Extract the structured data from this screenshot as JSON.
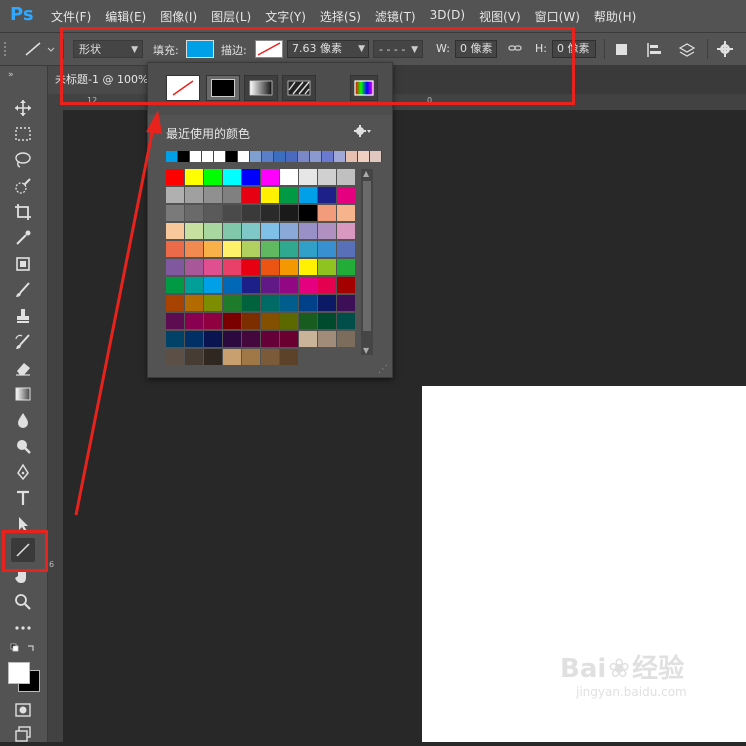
{
  "app": {
    "logo": "Ps"
  },
  "menu": [
    "文件(F)",
    "编辑(E)",
    "图像(I)",
    "图层(L)",
    "文字(Y)",
    "选择(S)",
    "滤镜(T)",
    "3D(D)",
    "视图(V)",
    "窗口(W)",
    "帮助(H)"
  ],
  "options": {
    "shape_mode": "形状",
    "fill_label": "填充:",
    "fill_color": "#00a0e9",
    "stroke_label": "描边:",
    "stroke_width": "7.63 像素",
    "w_label": "W:",
    "w_value": "0 像素",
    "h_label": "H:",
    "h_value": "0 像素"
  },
  "document": {
    "tab_title": "未标题-1 @ 100%"
  },
  "popup": {
    "recent_label": "最近使用的颜色",
    "recent_colors": [
      "#00a0e9",
      "#000000",
      "#ffffff",
      "#ffffff",
      "#ffffff",
      "#000000",
      "#ffffff",
      "#7f9fd0",
      "#5b7ec8",
      "#3c6ec0",
      "#4a6ac0",
      "#7b88c8",
      "#8a9ad0",
      "#6a7ad0",
      "#a0a8d8",
      "#e8c0b0",
      "#f0d0c0",
      "#e0c8c0"
    ],
    "swatches": [
      "#ff0000",
      "#ffff00",
      "#00ff00",
      "#00ffff",
      "#0000ff",
      "#ff00ff",
      "#ffffff",
      "#e6e6e6",
      "#d0d0d0",
      "#c0c0c0",
      "#b0b0b0",
      "#a0a0a0",
      "#909090",
      "#808080",
      "#e60012",
      "#fff100",
      "#009944",
      "#00a0e9",
      "#1d2088",
      "#e4007f",
      "#7a7a7a",
      "#6a6a6a",
      "#5a5a5a",
      "#4a4a4a",
      "#3a3a3a",
      "#2a2a2a",
      "#1a1a1a",
      "#000000",
      "#f29c7c",
      "#f5b48c",
      "#f8c89a",
      "#c7e0a0",
      "#a8d8a0",
      "#80c8a8",
      "#80c8c8",
      "#80c0e8",
      "#8aa8d8",
      "#9a90c8",
      "#b090c0",
      "#d898c0",
      "#ea6a4a",
      "#f08a50",
      "#f8b048",
      "#fff06a",
      "#b0d060",
      "#60b860",
      "#30a890",
      "#30a0c8",
      "#3890d0",
      "#5870b8",
      "#8058a0",
      "#a85898",
      "#e05090",
      "#e84068",
      "#e60012",
      "#ea5514",
      "#f39800",
      "#fff100",
      "#8fc31f",
      "#22ac38",
      "#009944",
      "#009e96",
      "#00a0e9",
      "#0068b7",
      "#1d2088",
      "#601986",
      "#920783",
      "#e4007f",
      "#e5004f",
      "#a40000",
      "#a84200",
      "#b36b00",
      "#7c8e00",
      "#1e7b2b",
      "#00633e",
      "#006b64",
      "#005e8d",
      "#004189",
      "#0c1a66",
      "#3c0f56",
      "#5e0c52",
      "#8a0050",
      "#8e0040",
      "#7a0000",
      "#7c2e00",
      "#825000",
      "#5c6800",
      "#185c20",
      "#004a2e",
      "#004e4a",
      "#004268",
      "#003066",
      "#0a1450",
      "#2c0a40",
      "#44083c",
      "#660038",
      "#6a0030",
      "#c9b49a",
      "#a08c78",
      "#7c6c5c",
      "#5c5046",
      "#463c34",
      "#302820",
      "#c8a070",
      "#a07848",
      "#7a5a38",
      "#5c4228"
    ]
  },
  "watermark": {
    "brand": "Bai",
    "brand2": "经验",
    "url": "jingyan.baidu.com"
  }
}
